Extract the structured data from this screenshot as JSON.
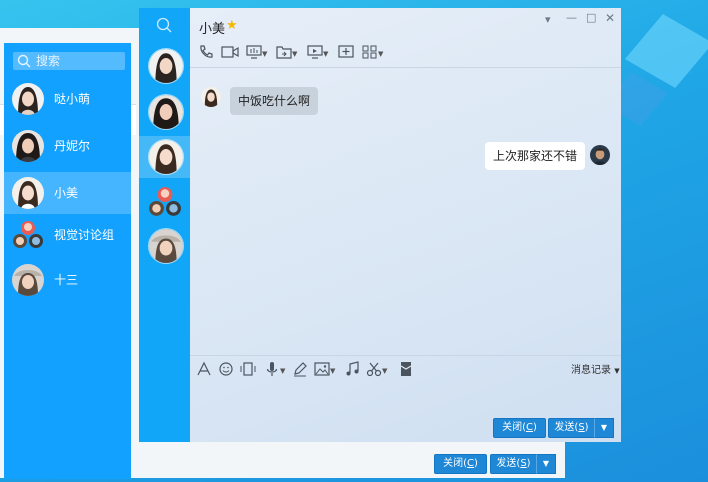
{
  "search": {
    "placeholder": "搜索"
  },
  "contacts": [
    {
      "name": "哒小萌"
    },
    {
      "name": "丹妮尔"
    },
    {
      "name": "小美"
    },
    {
      "name": "视觉讨论组"
    },
    {
      "name": "十三"
    }
  ],
  "chat": {
    "title": "小美",
    "messages": [
      {
        "side": "left",
        "text": "中饭吃什么啊"
      },
      {
        "side": "right",
        "text": "上次那家还不错"
      }
    ],
    "history_label": "消息记录",
    "close_label": "关闭(",
    "close_key": "C",
    "send_label": "发送(",
    "send_key": "S",
    "paren_close": ")"
  },
  "colors": {
    "accent": "#12a1ff",
    "button": "#1e87d6"
  }
}
